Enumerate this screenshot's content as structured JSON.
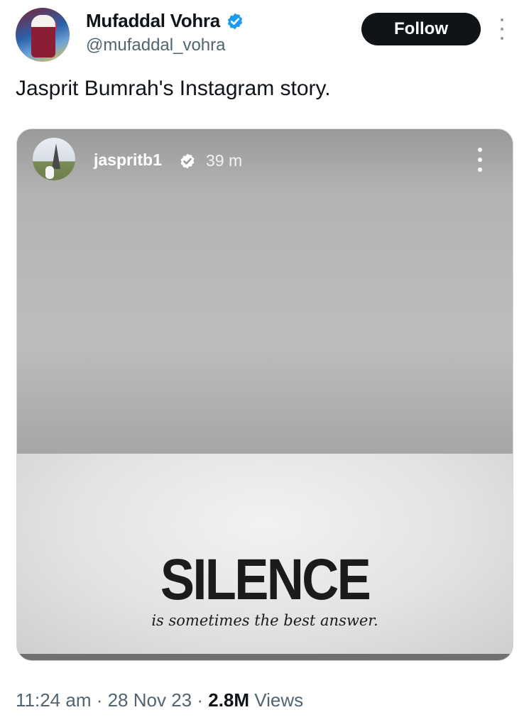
{
  "author": {
    "name": "Mufaddal Vohra",
    "handle": "@mufaddal_vohra",
    "verified_icon": "verified-badge-icon",
    "verified_color": "#1d9bf0"
  },
  "follow_label": "Follow",
  "tweet_text": "Jasprit Bumrah's Instagram story.",
  "story": {
    "username": "jaspritb1",
    "time": "39 m",
    "headline": "SILENCE",
    "subtitle": "is sometimes the best answer."
  },
  "meta": {
    "time": "11:24 am",
    "sep1": " · ",
    "date": "28 Nov 23",
    "sep2": " · ",
    "views_count": "2.8M",
    "views_label": " Views"
  }
}
